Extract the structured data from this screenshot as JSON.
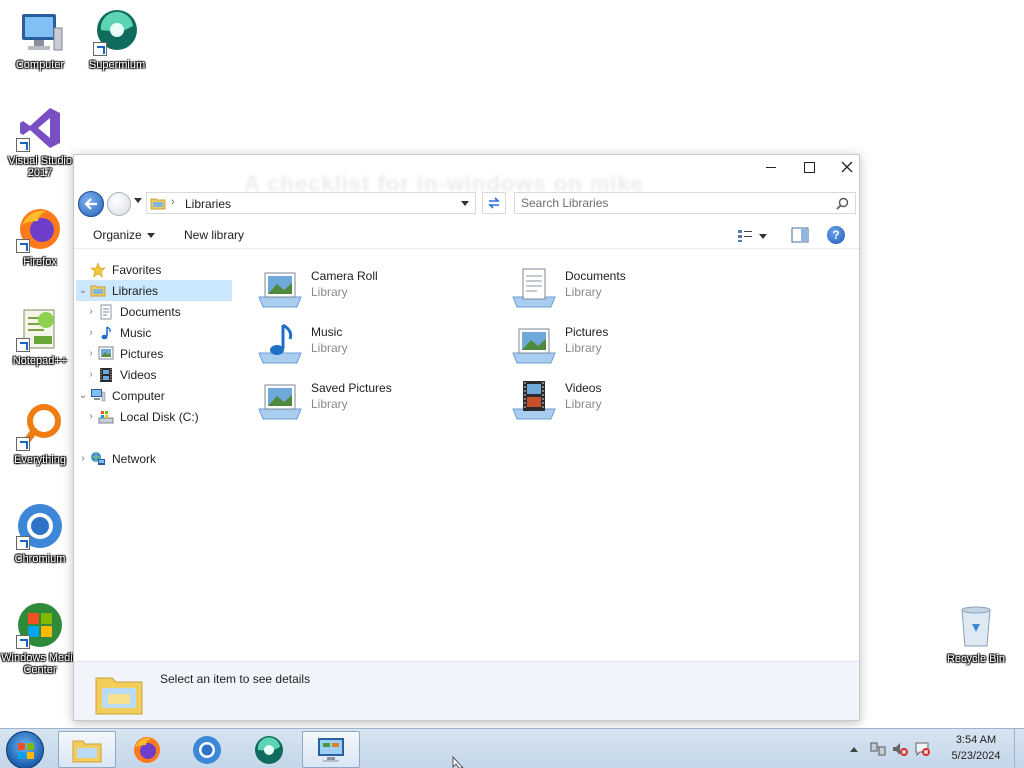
{
  "desktop": {
    "icons": [
      {
        "label": "Computer",
        "icon": "computer-icon"
      },
      {
        "label": "Supermium",
        "icon": "supermium-icon"
      },
      {
        "label": "Visual Studio 2017",
        "icon": "visual-studio-icon"
      },
      {
        "label": "Firefox",
        "icon": "firefox-icon"
      },
      {
        "label": "Notepad++",
        "icon": "notepadpp-icon"
      },
      {
        "label": "Everything",
        "icon": "everything-icon"
      },
      {
        "label": "Chromium",
        "icon": "chromium-icon"
      },
      {
        "label": "Windows Media Center",
        "icon": "media-center-icon"
      },
      {
        "label": "Recycle Bin",
        "icon": "recycle-bin-icon"
      }
    ]
  },
  "window": {
    "title_watermark": "A checklist for in-windows on mike",
    "address": {
      "path": "Libraries"
    },
    "search": {
      "placeholder": "Search Libraries"
    },
    "toolbar": {
      "organize": "Organize",
      "new_library": "New library",
      "help": "?"
    },
    "nav": [
      {
        "label": "Favorites",
        "icon": "star-icon"
      },
      {
        "label": "Libraries",
        "icon": "libraries-icon",
        "selected": true
      },
      {
        "label": "Documents",
        "icon": "documents-icon"
      },
      {
        "label": "Music",
        "icon": "music-icon"
      },
      {
        "label": "Pictures",
        "icon": "pictures-icon"
      },
      {
        "label": "Videos",
        "icon": "videos-icon"
      },
      {
        "label": "Computer",
        "icon": "computer-icon"
      },
      {
        "label": "Local Disk (C:)",
        "icon": "disk-icon"
      },
      {
        "label": "Network",
        "icon": "network-icon"
      }
    ],
    "libraries": [
      {
        "name": "Camera Roll",
        "type": "Library",
        "icon": "camera-roll-icon"
      },
      {
        "name": "Documents",
        "type": "Library",
        "icon": "documents-library-icon"
      },
      {
        "name": "Music",
        "type": "Library",
        "icon": "music-library-icon"
      },
      {
        "name": "Pictures",
        "type": "Library",
        "icon": "pictures-library-icon"
      },
      {
        "name": "Saved Pictures",
        "type": "Library",
        "icon": "saved-pictures-icon"
      },
      {
        "name": "Videos",
        "type": "Library",
        "icon": "videos-library-icon"
      }
    ],
    "details": {
      "message": "Select an item to see details"
    }
  },
  "taskbar": {
    "apps": [
      "file-explorer-icon",
      "firefox-icon",
      "chromium-icon",
      "supermium-icon",
      "control-panel-icon"
    ],
    "clock": {
      "time": "3:54 AM",
      "date": "5/23/2024"
    }
  }
}
